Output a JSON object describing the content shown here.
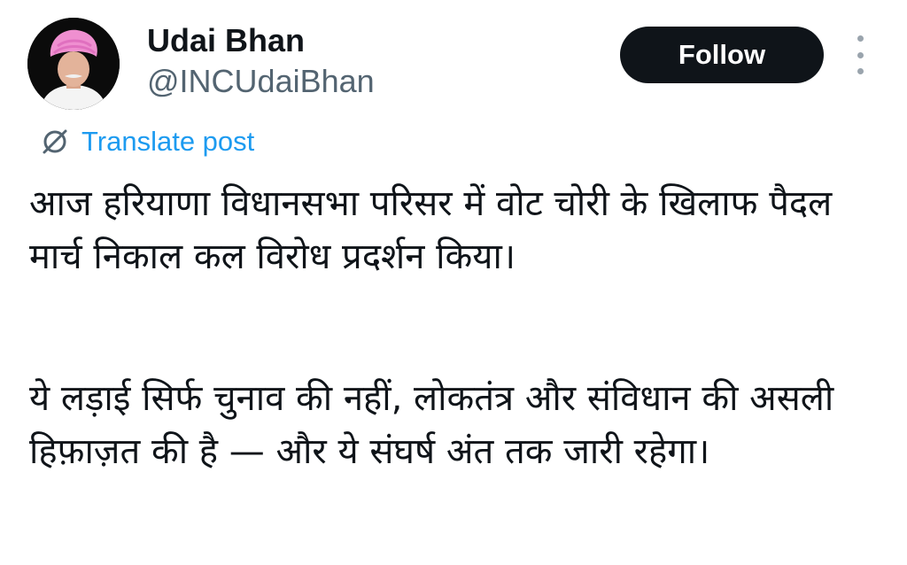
{
  "author": {
    "display_name": "Udai Bhan",
    "handle": "@INCUdaiBhan",
    "avatar_icon": "profile-photo"
  },
  "actions": {
    "follow_label": "Follow",
    "more_icon": "more-vertical-icon"
  },
  "translate": {
    "icon": "translate-globe-icon",
    "label": "Translate post",
    "color": "#1d9bf0"
  },
  "post": {
    "paragraph_1": "आज हरियाणा विधानसभा परिसर में वोट चोरी के खिलाफ पैदल मार्च निकाल कल विरोध प्रदर्शन किया।",
    "paragraph_2": "ये लड़ाई सिर्फ चुनाव की नहीं, लोकतंत्र और संविधान की असली हिफ़ाज़त की है — और ये संघर्ष अंत तक जारी रहेगा।"
  },
  "colors": {
    "text": "#0f1419",
    "secondary": "#536471",
    "button_bg": "#0f1419",
    "button_text": "#ffffff"
  }
}
